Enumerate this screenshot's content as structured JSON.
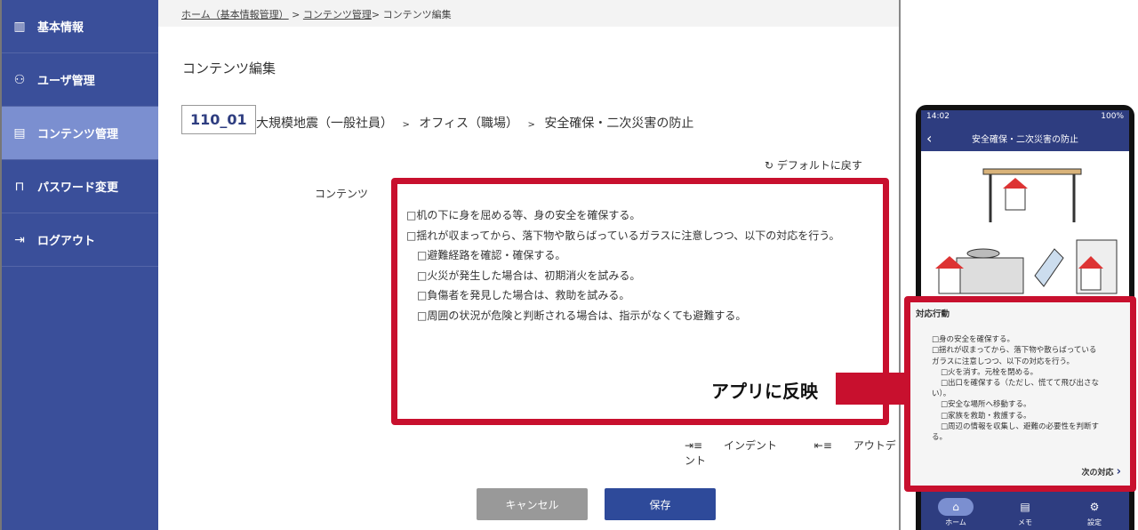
{
  "sidebar": {
    "items": [
      {
        "label": "基本情報",
        "icon": "building-icon"
      },
      {
        "label": "ユーザ管理",
        "icon": "user-icon"
      },
      {
        "label": "コンテンツ管理",
        "icon": "clipboard-icon",
        "active": true
      },
      {
        "label": "パスワード変更",
        "icon": "lock-icon"
      },
      {
        "label": "ログアウト",
        "icon": "logout-icon"
      }
    ]
  },
  "breadcrumb": {
    "home": "ホーム（基本情報管理）",
    "sep": ">",
    "contents": "コンテンツ管理",
    "current": "コンテンツ編集"
  },
  "page": {
    "title": "コンテンツ編集",
    "id": "110_01",
    "path": [
      "大規模地震（一般社員）",
      "オフィス（職場）",
      "安全確保・二次災害の防止"
    ],
    "path_sep": ">",
    "reset": "デフォルトに戻す",
    "content_label": "コンテンツ"
  },
  "editor": {
    "lines": [
      "□机の下に身を屈める等、身の安全を確保する。",
      "□揺れが収まってから、落下物や散らばっているガラスに注意しつつ、以下の対応を行う。",
      "□避難経路を確認・確保する。",
      "□火災が発生した場合は、初期消火を試みる。",
      "□負傷者を発見した場合は、救助を試みる。",
      "□周囲の状況が危険と判断される場合は、指示がなくても避難する。"
    ]
  },
  "tools": {
    "indent": "インデント",
    "outdent": "アウトデント"
  },
  "buttons": {
    "cancel": "キャンセル",
    "save": "保存"
  },
  "annotation": {
    "label": "アプリに反映",
    "color": "#c8102e"
  },
  "phone": {
    "time": "14:02",
    "battery": "100%",
    "header": "安全確保・二次災害の防止",
    "section": "対応行動",
    "lines": [
      "□身の安全を確保する。",
      "□揺れが収まってから、落下物や散らばっている",
      "ガラスに注意しつつ、以下の対応を行う。",
      "□火を消す。元栓を閉める。",
      "□出口を確保する（ただし、慌てて飛び出さな",
      "い）。",
      "□安全な場所へ移動する。",
      "□家族を救助・救護する。",
      "□周辺の情報を収集し、避難の必要性を判断す",
      "る。"
    ],
    "next": "次の対応",
    "tabs": [
      "ホーム",
      "メモ",
      "設定"
    ]
  }
}
